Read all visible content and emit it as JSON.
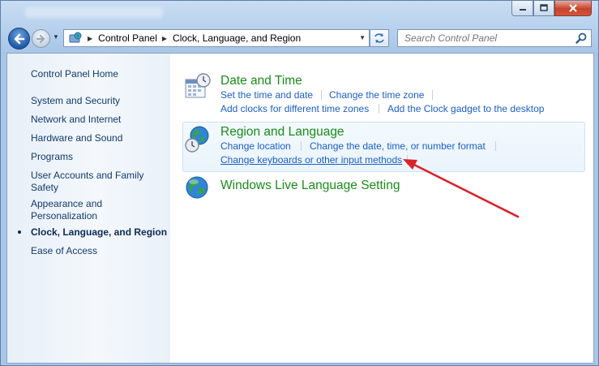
{
  "window": {
    "caption_buttons": [
      "minimize",
      "maximize",
      "close"
    ]
  },
  "address": {
    "crumbs": [
      "Control Panel",
      "Clock, Language, and Region"
    ]
  },
  "search": {
    "placeholder": "Search Control Panel"
  },
  "sidebar": {
    "home": "Control Panel Home",
    "items": [
      {
        "label": "System and Security",
        "active": false
      },
      {
        "label": "Network and Internet",
        "active": false
      },
      {
        "label": "Hardware and Sound",
        "active": false
      },
      {
        "label": "Programs",
        "active": false
      },
      {
        "label": "User Accounts and Family\nSafety",
        "active": false
      },
      {
        "label": "Appearance and\nPersonalization",
        "active": false
      },
      {
        "label": "Clock, Language, and Region",
        "active": true
      },
      {
        "label": "Ease of Access",
        "active": false
      }
    ]
  },
  "categories": [
    {
      "title": "Date and Time",
      "icon": "calendar-clock-icon",
      "links": [
        "Set the time and date",
        "Change the time zone",
        "Add clocks for different time zones",
        "Add the Clock gadget to the desktop"
      ]
    },
    {
      "title": "Region and Language",
      "icon": "globe-clock-icon",
      "links": [
        "Change location",
        "Change the date, time, or number format",
        "Change keyboards or other input methods"
      ],
      "hovered_link": "Change keyboards or other input methods"
    },
    {
      "title": "Windows Live Language Setting",
      "icon": "globe-icon",
      "links": []
    }
  ],
  "annotation": {
    "arrow_color": "#d9232b"
  },
  "colors": {
    "category_title": "#1a8d1a",
    "link": "#1c5ec7",
    "sidebar_text": "#123a6d"
  }
}
